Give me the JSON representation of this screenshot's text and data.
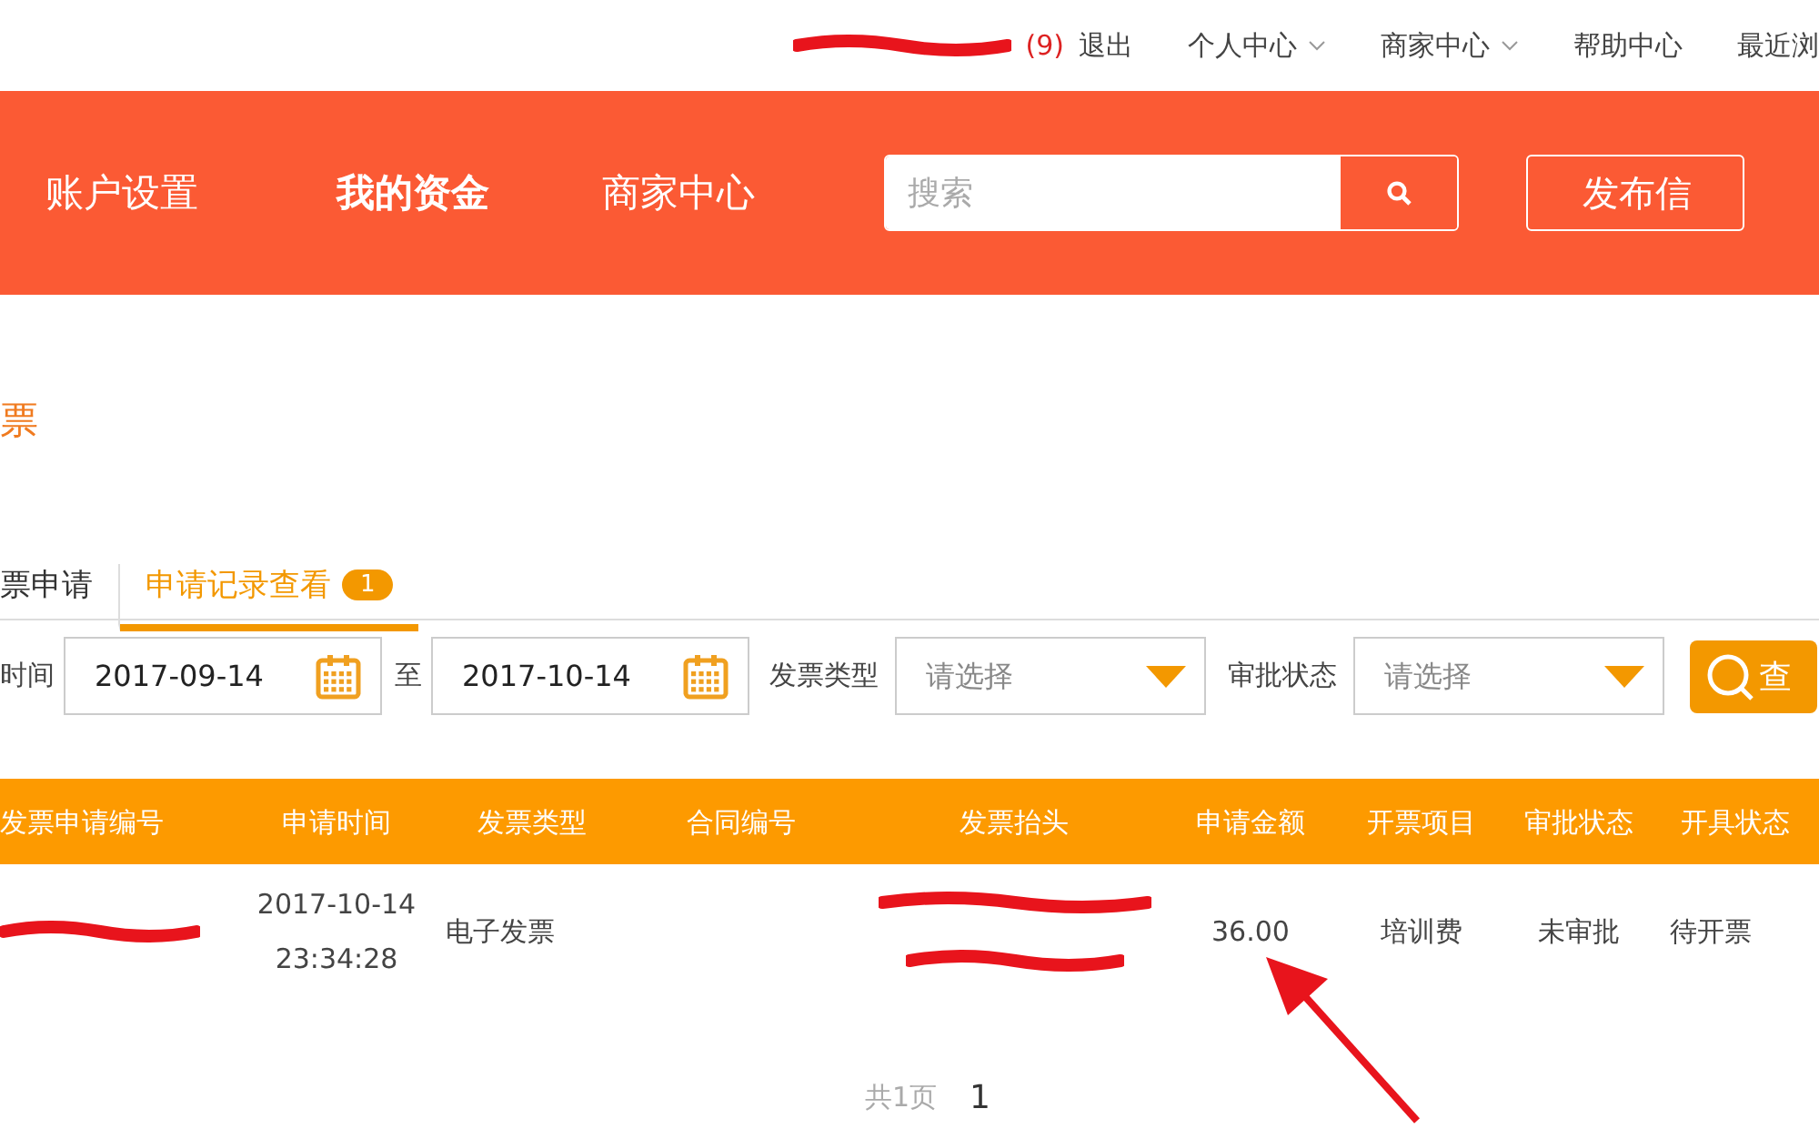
{
  "top_bar": {
    "user_count": "(9)",
    "logout": "退出",
    "links": [
      {
        "label": "个人中心",
        "dropdown": true
      },
      {
        "label": "商家中心",
        "dropdown": true
      },
      {
        "label": "帮助中心",
        "dropdown": false
      },
      {
        "label": "最近浏",
        "dropdown": false
      }
    ]
  },
  "nav": {
    "items": [
      {
        "label": "账户设置",
        "selected": false
      },
      {
        "label": "我的资金",
        "selected": true
      },
      {
        "label": "商家中心",
        "selected": false
      }
    ],
    "search": {
      "placeholder": "搜索"
    },
    "publish_button": "发布信"
  },
  "page_title": "票",
  "tabs": [
    {
      "label": "票申请",
      "selected": false
    },
    {
      "label": "申请记录查看",
      "selected": true,
      "badge": "1"
    }
  ],
  "filters": {
    "time_label": "时间",
    "date_from": "2017-09-14",
    "to_label": "至",
    "date_to": "2017-10-14",
    "type_label": "发票类型",
    "type_placeholder": "请选择",
    "status_label": "审批状态",
    "status_placeholder": "请选择",
    "search_button": "查"
  },
  "table": {
    "columns": [
      "发票申请编号",
      "申请时间",
      "发票类型",
      "合同编号",
      "发票抬头",
      "申请金额",
      "开票项目",
      "审批状态",
      "开具状态"
    ],
    "rows": [
      {
        "id_redacted": true,
        "time": [
          "2017-10-14",
          "23:34:28"
        ],
        "type": "电子发票",
        "contract": "",
        "title_redacted": true,
        "amount": "36.00",
        "item": "培训费",
        "approval": "未审批",
        "issue": "待开票"
      }
    ]
  },
  "pagination": {
    "total": "共1页",
    "pages": [
      {
        "label": "1",
        "selected": true
      }
    ]
  },
  "annotation": {
    "kind": "arrow"
  }
}
